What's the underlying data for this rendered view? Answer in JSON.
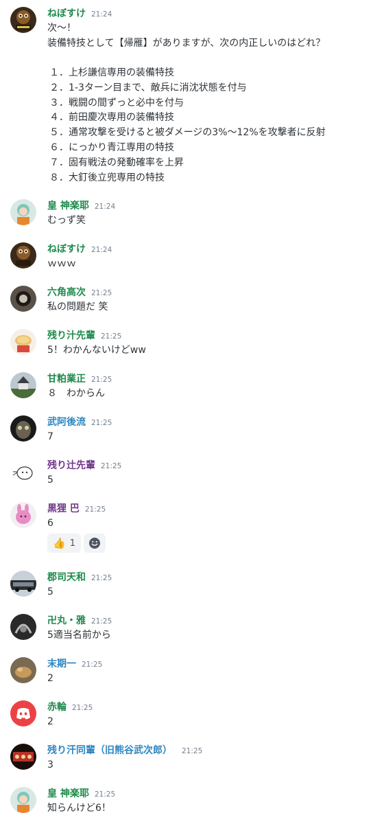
{
  "colors": {
    "green": "#2ecc71",
    "blue": "#3498db",
    "purple": "#71368a",
    "timestamp": "#747f8d",
    "text": "#2e3338"
  },
  "messages": [
    {
      "author": "ねぼすけ",
      "time": "21:24",
      "name_color": "#1f8b4c",
      "lines": [
        "次～！",
        "装備特技として【帰雁】がありますが、次の内正しいのはどれ？"
      ],
      "list": [
        "１．上杉謙信専用の装備特技",
        "２．1-3ターン目まで、敵兵に消沈状態を付与",
        "３．戦闘の間ずっと必中を付与",
        "４．前田慶次専用の装備特技",
        "５．通常攻撃を受けると被ダメージの3%～12%を攻撃者に反射",
        "６．にっかり青江専用の特技",
        "７．固有戦法の発動確率を上昇",
        "８．大釘後立兜専用の特技"
      ]
    },
    {
      "author": "皇 神楽耶",
      "time": "21:24",
      "name_color": "#1f8b4c",
      "lines": [
        "むっず笑"
      ]
    },
    {
      "author": "ねぼすけ",
      "time": "21:24",
      "name_color": "#1f8b4c",
      "lines": [
        "ｗｗｗ"
      ]
    },
    {
      "author": "六角高次",
      "time": "21:25",
      "name_color": "#1f8b4c",
      "lines": [
        "私の問題だ 笑"
      ]
    },
    {
      "author": "残り汁先輩",
      "time": "21:25",
      "name_color": "#1f8b4c",
      "lines": [
        "5！わかんないけどww"
      ]
    },
    {
      "author": "甘粕業正",
      "time": "21:25",
      "name_color": "#1f8b4c",
      "lines": [
        "８　わからん"
      ]
    },
    {
      "author": "武阿後流",
      "time": "21:25",
      "name_color": "#2e86c1",
      "lines": [
        "7"
      ]
    },
    {
      "author": "残り辻先輩",
      "time": "21:25",
      "name_color": "#71368a",
      "lines": [
        "5"
      ]
    },
    {
      "author": "黒狸 巴",
      "time": "21:25",
      "name_color": "#71368a",
      "lines": [
        "6"
      ],
      "reactions": [
        {
          "emoji": "👍",
          "count": "1"
        }
      ]
    },
    {
      "author": "郡司天和",
      "time": "21:25",
      "name_color": "#1f8b4c",
      "lines": [
        "5"
      ]
    },
    {
      "author": "卍丸・雅",
      "time": "21:25",
      "name_color": "#1f8b4c",
      "lines": [
        "5適当名前から"
      ]
    },
    {
      "author": "末期一",
      "time": "21:25",
      "name_color": "#2e86c1",
      "lines": [
        "2"
      ]
    },
    {
      "author": "赤輪",
      "time": "21:25",
      "name_color": "#1f8b4c",
      "lines": [
        "2"
      ]
    },
    {
      "author": "残り汗同輩（旧熊谷武次郎）",
      "time": "21:25",
      "name_color": "#2e86c1",
      "lines": [
        "3"
      ]
    },
    {
      "author": "皇 神楽耶",
      "time": "21:25",
      "name_color": "#1f8b4c",
      "lines": [
        "知らんけど6！"
      ]
    }
  ]
}
